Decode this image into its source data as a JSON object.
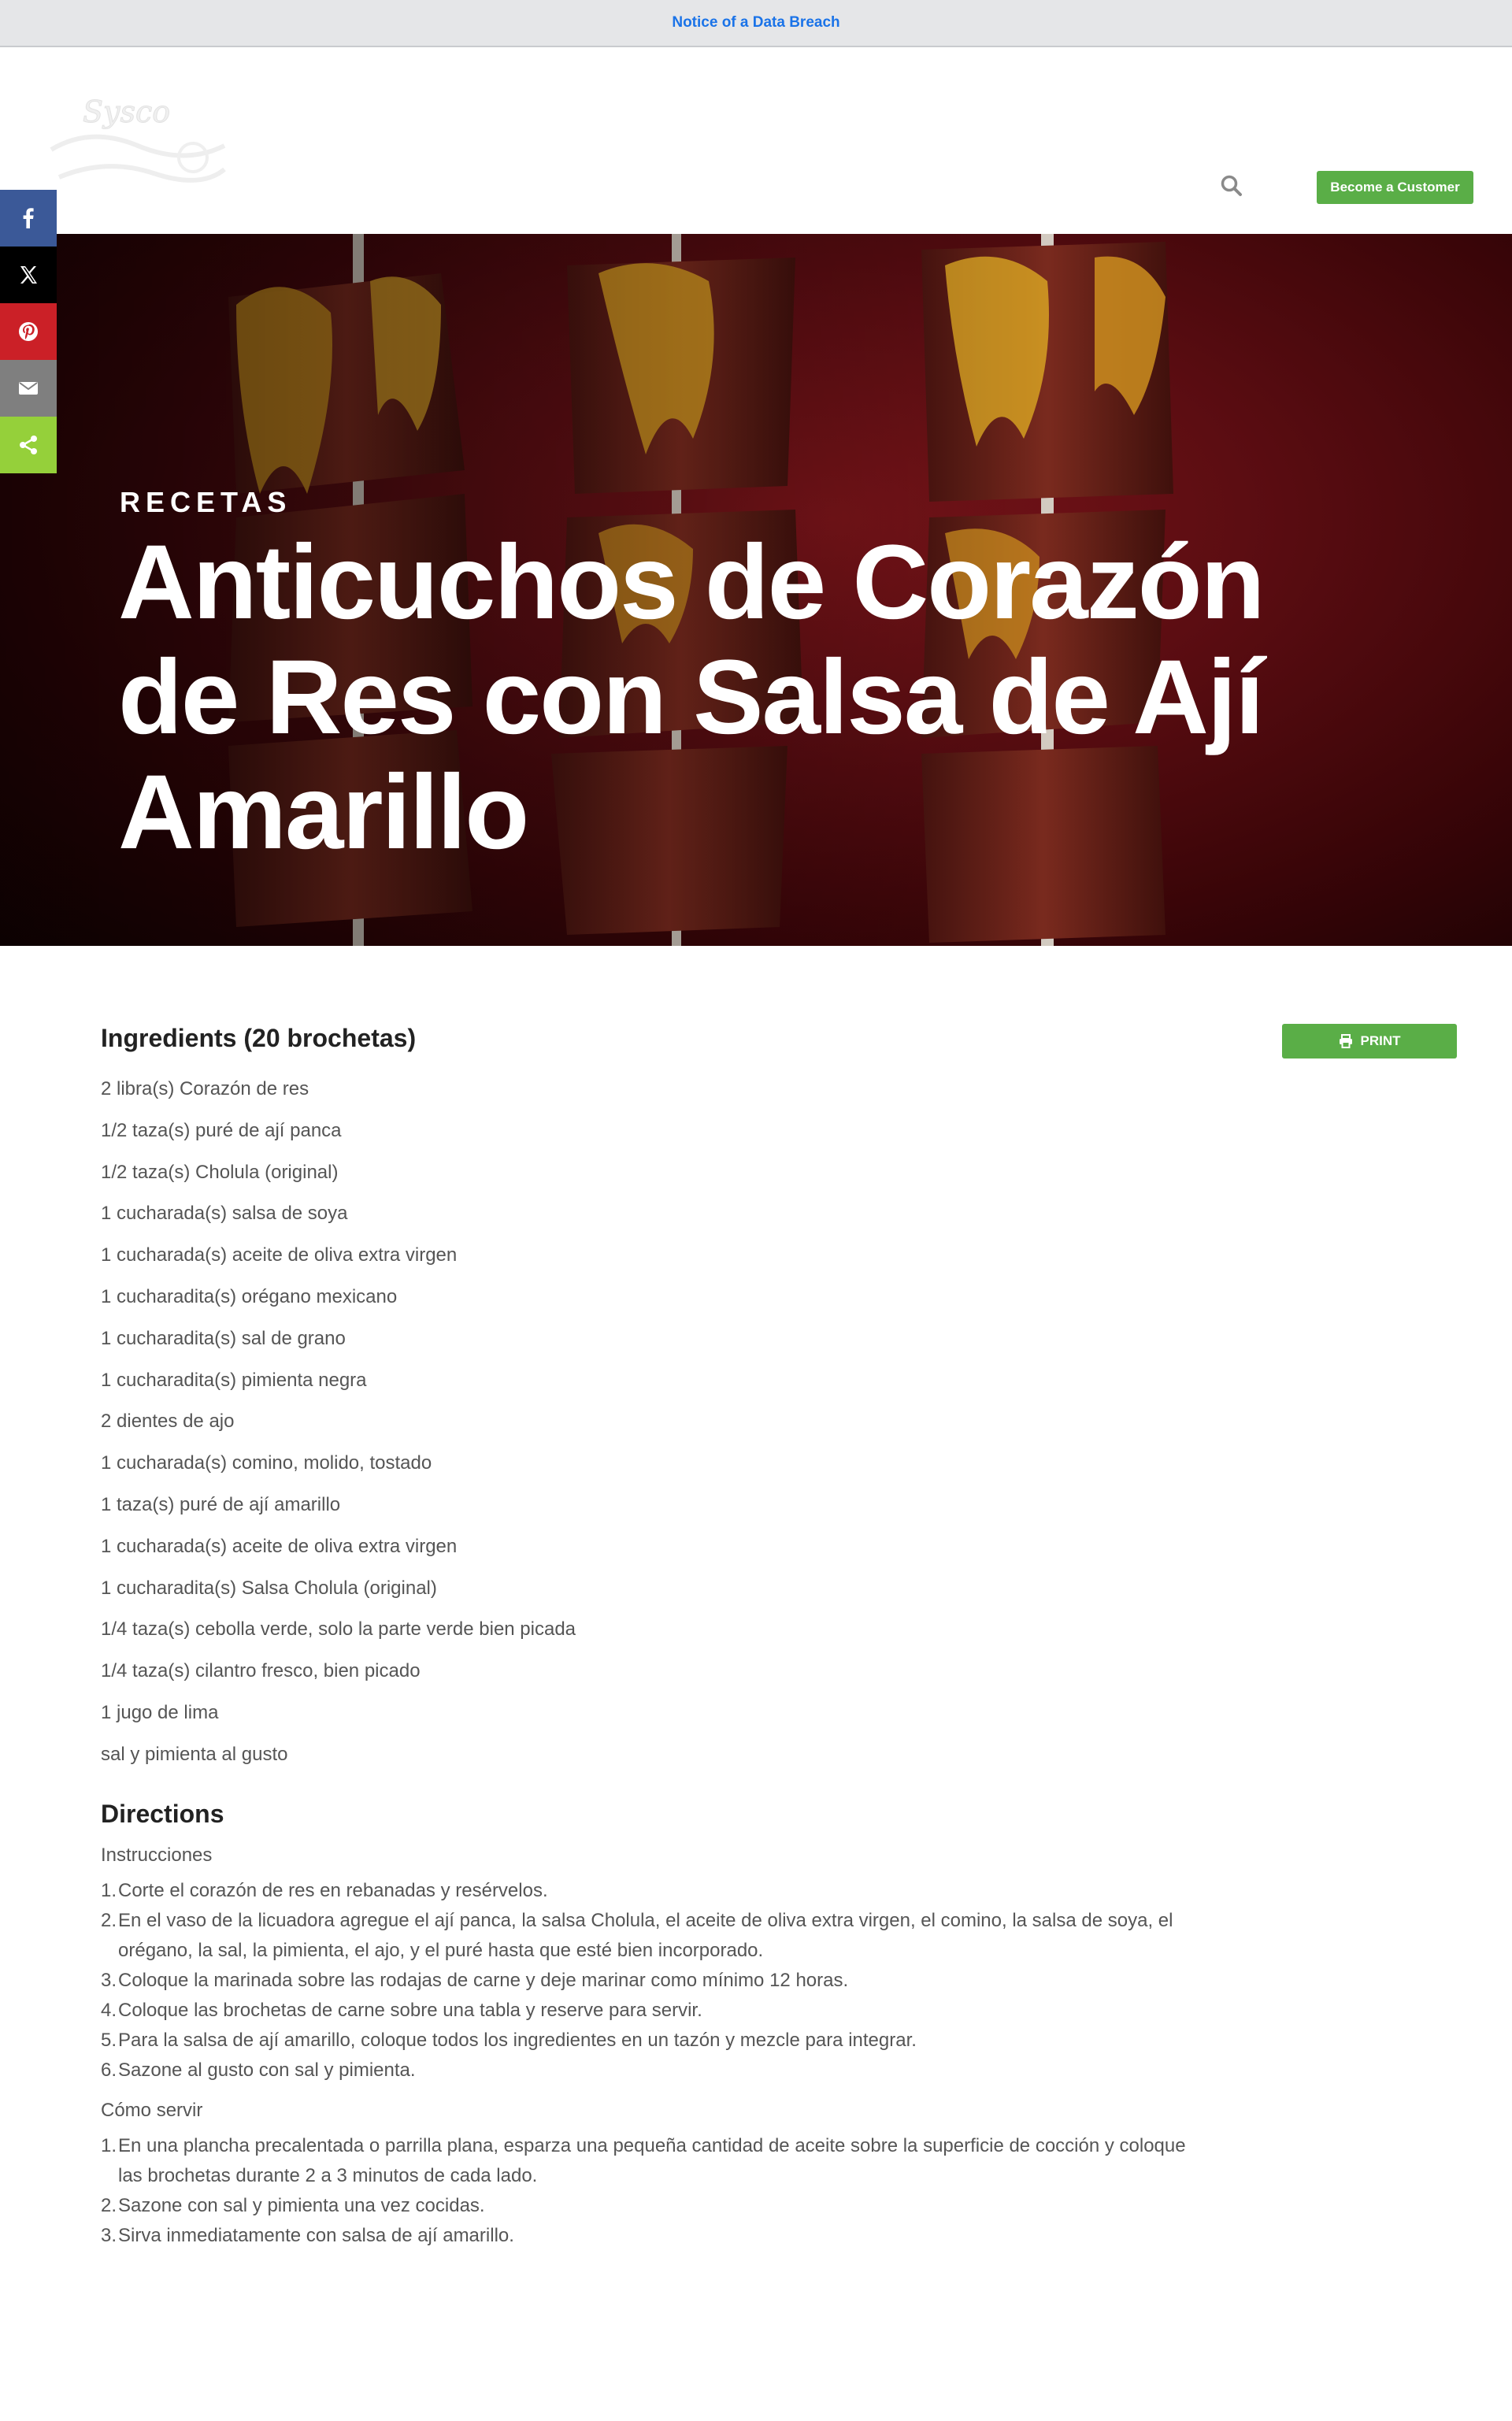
{
  "notice": {
    "text": "Notice of a Data Breach"
  },
  "header": {
    "logo_label": "Sysco",
    "search_icon": "search-icon",
    "cta_label": "Become a Customer"
  },
  "share": {
    "items": [
      {
        "name": "facebook",
        "color": "#3b5998",
        "icon": "facebook-icon"
      },
      {
        "name": "x",
        "color": "#000000",
        "icon": "x-icon"
      },
      {
        "name": "pinterest",
        "color": "#cb2027",
        "icon": "pinterest-icon"
      },
      {
        "name": "email",
        "color": "#7f7f7f",
        "icon": "email-icon"
      },
      {
        "name": "share",
        "color": "#95d03a",
        "icon": "share-icon"
      }
    ]
  },
  "hero": {
    "eyebrow": "RECETAS",
    "title": "Anticuchos de Corazón de Res con Salsa de Ají Amarillo"
  },
  "ingredients": {
    "title": "Ingredients (20 brochetas)",
    "print_label": "PRINT",
    "items": [
      "2 libra(s) Corazón de res",
      "1/2 taza(s) puré de ají panca",
      "1/2 taza(s) Cholula (original)",
      "1 cucharada(s) salsa de soya",
      "1 cucharada(s) aceite de oliva extra virgen",
      "1 cucharadita(s) orégano mexicano",
      "1 cucharadita(s) sal de grano",
      "1 cucharadita(s) pimienta negra",
      "2 dientes de ajo",
      "1 cucharada(s) comino, molido, tostado",
      "1 taza(s) puré de ají amarillo",
      "1 cucharada(s) aceite de oliva extra virgen",
      "1 cucharadita(s) Salsa Cholula (original)",
      "1/4 taza(s) cebolla verde, solo la parte verde bien picada",
      "1/4 taza(s) cilantro fresco, bien picado",
      "1 jugo de lima",
      "sal y pimienta al gusto"
    ]
  },
  "directions": {
    "title": "Directions",
    "instructions_heading": "Instrucciones",
    "instructions": [
      "Corte el corazón de res en rebanadas y resérvelos.",
      "En el vaso de la licuadora agregue el ají panca, la salsa Cholula, el aceite de oliva extra virgen, el comino, la salsa de soya, el orégano, la sal, la pimienta, el ajo, y el puré hasta que esté bien incorporado.",
      "Coloque la marinada sobre las rodajas de carne y deje marinar como mínimo 12 horas.",
      "Coloque las brochetas de carne sobre una tabla y reserve para servir.",
      "Para la salsa de ají amarillo, coloque todos los ingredientes en un tazón y mezcle para integrar.",
      "Sazone al gusto con sal y pimienta."
    ],
    "serve_heading": "Cómo servir",
    "serve": [
      "En una plancha precalentada o parrilla plana, esparza una pequeña cantidad de aceite sobre la superficie de cocción y coloque las brochetas durante 2 a 3 minutos de cada lado.",
      "Sazone con sal y pimienta una vez cocidas.",
      "Sirva inmediatamente con salsa de ají amarillo."
    ]
  }
}
